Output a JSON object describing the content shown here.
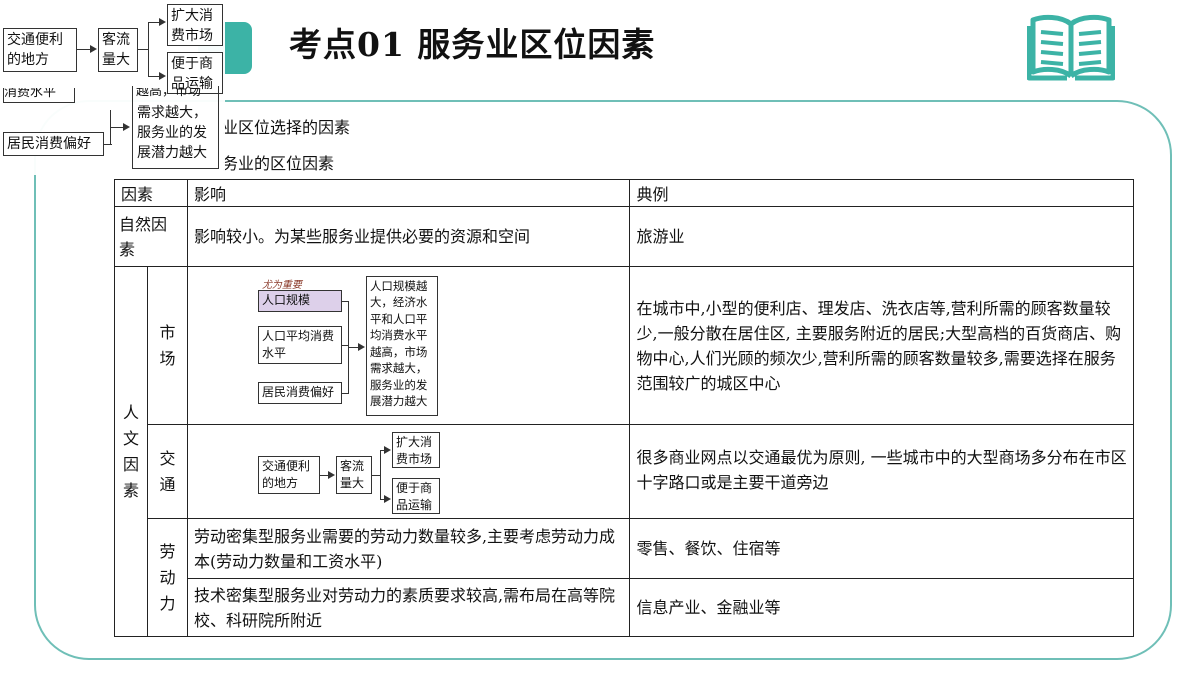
{
  "header": {
    "badge_char": "",
    "title": "考点01 服务业区位因素"
  },
  "sections": {
    "s1": "业区位选择的因素",
    "s2": "务业的区位因素"
  },
  "table": {
    "headers": [
      "因素",
      "影响",
      "典例"
    ],
    "natural": {
      "factor": "自然因素",
      "influence": "影响较小。为某些服务业提供必要的资源和空间",
      "example": "旅游业"
    },
    "human_label": "人文因素",
    "market": {
      "factor": "市场",
      "diagram": {
        "note": "尤为重要",
        "left": [
          "人口规模",
          "人口平均消费水平",
          "居民消费偏好"
        ],
        "right": "人口规模越大，经济水平和人口平均消费水平越高，市场需求越大，服务业的发展潜力越大"
      },
      "example": "在城市中,小型的便利店、理发店、洗衣店等,营利所需的顾客数量较少,一般分散在居住区, 主要服务附近的居民;大型高档的百货商店、购物中心,人们光顾的频次少,营利所需的顾客数量较多,需要选择在服务范围较广的城区中心"
    },
    "transport": {
      "factor": "交通",
      "diagram": {
        "a": "交通便利的地方",
        "b": "客流量大",
        "c1": "扩大消费市场",
        "c2": "便于商品运输"
      },
      "example": "很多商业网点以交通最优为原则, 一些城市中的大型商场多分布在市区十字路口或是主要干道旁边"
    },
    "labor": {
      "factor": "劳动力",
      "rows": [
        {
          "influence": "劳动密集型服务业需要的劳动力数量较多,主要考虑劳动力成本(劳动力数量和工资水平)",
          "example": "零售、餐饮、住宿等"
        },
        {
          "influence": "技术密集型服务业对劳动力的素质要求较高,需布局在高等院校、科研院所附近",
          "example": "信息产业、金融业等"
        }
      ]
    }
  },
  "overlay": {
    "a": "交通便利的地方",
    "b": "客流量大",
    "c1": "扩大消费市场",
    "c2": "便于商品运输",
    "partial1": "消费水平",
    "partial2": "越高，市场",
    "right": "需求越大，服务业的发展潜力越大",
    "pref": "居民消费偏好"
  },
  "icons": {
    "book": "open-book-icon",
    "color": "#3cb3a6"
  }
}
